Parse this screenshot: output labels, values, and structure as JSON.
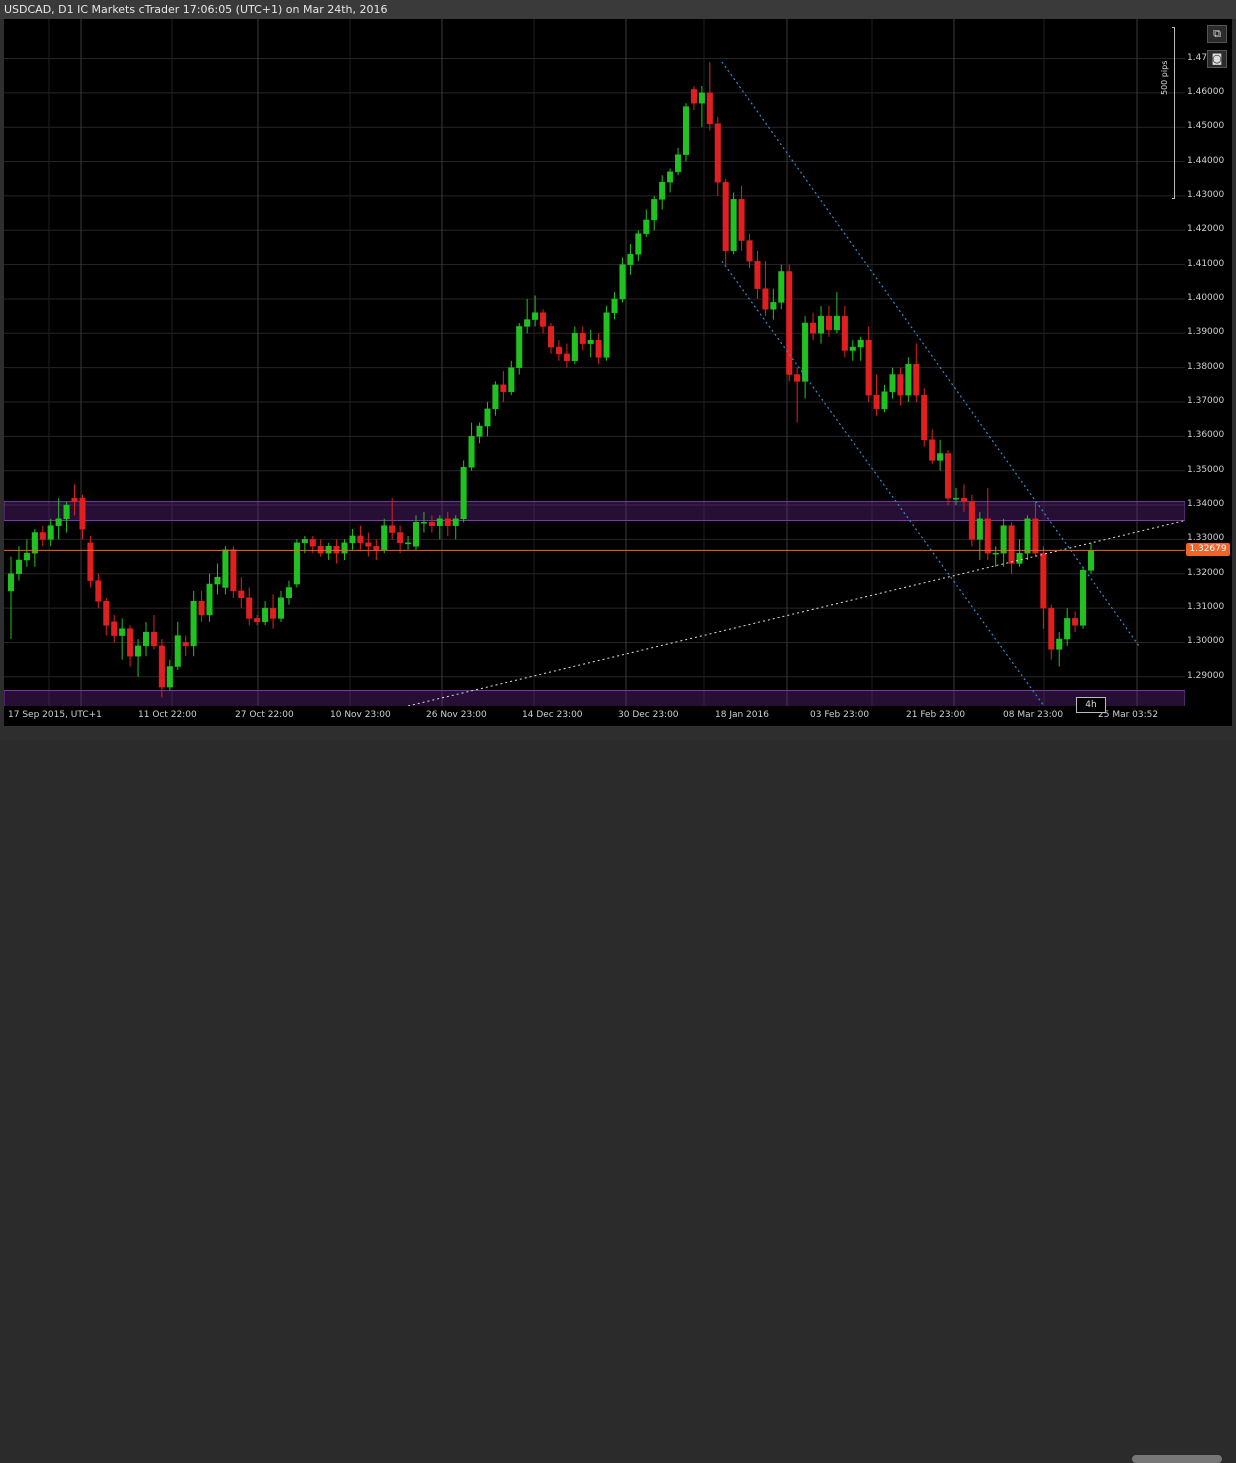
{
  "window": {
    "title": "USDCAD, D1 IC Markets cTrader 17:06:05 (UTC+1) on Mar 24th, 2016"
  },
  "toolbar": {
    "detach_icon": "detach-icon",
    "camera_icon": "camera-icon"
  },
  "measure": {
    "pips_label": "500 pips"
  },
  "price_axis": {
    "ticks": [
      "1.47000",
      "1.46000",
      "1.45000",
      "1.44000",
      "1.43000",
      "1.42000",
      "1.41000",
      "1.40000",
      "1.39000",
      "1.38000",
      "1.37000",
      "1.36000",
      "1.35000",
      "1.34000",
      "1.33000",
      "1.32000",
      "1.31000",
      "1.30000",
      "1.29000"
    ],
    "current_price": "1.32679"
  },
  "time_axis": {
    "ticks": [
      "17 Sep 2015, UTC+1",
      "11 Oct 22:00",
      "27 Oct 22:00",
      "10 Nov 23:00",
      "26 Nov 23:00",
      "14 Dec 23:00",
      "30 Dec 23:00",
      "18 Jan 2016",
      "03 Feb 23:00",
      "21 Feb 23:00",
      "08 Mar 23:00",
      "25 Mar 03:52"
    ],
    "timeframe": "4h"
  },
  "colors": {
    "bull": "#22c122",
    "bear": "#e02020",
    "zone": "#7a3aa8",
    "channel": "#2a8fd8",
    "price_line": "#f0642a"
  },
  "chart_data": {
    "type": "candlestick",
    "symbol": "USDCAD",
    "timeframe": "D1",
    "ylim": [
      1.2815,
      1.4815
    ],
    "current_price": 1.32679,
    "ohlc": [
      [
        1.315,
        1.325,
        1.301,
        1.32
      ],
      [
        1.32,
        1.328,
        1.318,
        1.324
      ],
      [
        1.324,
        1.33,
        1.322,
        1.326
      ],
      [
        1.326,
        1.333,
        1.322,
        1.332
      ],
      [
        1.332,
        1.334,
        1.328,
        1.33
      ],
      [
        1.33,
        1.336,
        1.328,
        1.334
      ],
      [
        1.334,
        1.342,
        1.33,
        1.336
      ],
      [
        1.336,
        1.341,
        1.332,
        1.34
      ],
      [
        1.342,
        1.346,
        1.337,
        1.341
      ],
      [
        1.342,
        1.343,
        1.33,
        1.333
      ],
      [
        1.329,
        1.331,
        1.316,
        1.318
      ],
      [
        1.318,
        1.32,
        1.31,
        1.312
      ],
      [
        1.312,
        1.313,
        1.302,
        1.305
      ],
      [
        1.306,
        1.308,
        1.3,
        1.302
      ],
      [
        1.302,
        1.307,
        1.295,
        1.304
      ],
      [
        1.304,
        1.305,
        1.293,
        1.296
      ],
      [
        1.296,
        1.301,
        1.29,
        1.299
      ],
      [
        1.299,
        1.306,
        1.296,
        1.303
      ],
      [
        1.303,
        1.308,
        1.298,
        1.299
      ],
      [
        1.299,
        1.301,
        1.284,
        1.287
      ],
      [
        1.287,
        1.295,
        1.286,
        1.293
      ],
      [
        1.293,
        1.306,
        1.292,
        1.302
      ],
      [
        1.3,
        1.302,
        1.296,
        1.299
      ],
      [
        1.299,
        1.315,
        1.296,
        1.312
      ],
      [
        1.312,
        1.315,
        1.306,
        1.308
      ],
      [
        1.308,
        1.32,
        1.306,
        1.317
      ],
      [
        1.317,
        1.323,
        1.314,
        1.319
      ],
      [
        1.316,
        1.328,
        1.314,
        1.327
      ],
      [
        1.327,
        1.328,
        1.313,
        1.315
      ],
      [
        1.315,
        1.319,
        1.31,
        1.313
      ],
      [
        1.313,
        1.316,
        1.305,
        1.307
      ],
      [
        1.307,
        1.308,
        1.305,
        1.306
      ],
      [
        1.306,
        1.312,
        1.305,
        1.31
      ],
      [
        1.31,
        1.314,
        1.304,
        1.307
      ],
      [
        1.307,
        1.315,
        1.306,
        1.313
      ],
      [
        1.313,
        1.318,
        1.311,
        1.316
      ],
      [
        1.317,
        1.33,
        1.316,
        1.329
      ],
      [
        1.329,
        1.331,
        1.326,
        1.33
      ],
      [
        1.33,
        1.331,
        1.326,
        1.328
      ],
      [
        1.328,
        1.33,
        1.325,
        1.326
      ],
      [
        1.326,
        1.329,
        1.324,
        1.328
      ],
      [
        1.328,
        1.33,
        1.323,
        1.326
      ],
      [
        1.326,
        1.33,
        1.324,
        1.329
      ],
      [
        1.329,
        1.333,
        1.327,
        1.331
      ],
      [
        1.331,
        1.334,
        1.327,
        1.329
      ],
      [
        1.329,
        1.332,
        1.325,
        1.328
      ],
      [
        1.328,
        1.33,
        1.324,
        1.327
      ],
      [
        1.327,
        1.336,
        1.326,
        1.334
      ],
      [
        1.334,
        1.342,
        1.33,
        1.332
      ],
      [
        1.332,
        1.334,
        1.326,
        1.329
      ],
      [
        1.329,
        1.331,
        1.327,
        1.329
      ],
      [
        1.328,
        1.337,
        1.327,
        1.335
      ],
      [
        1.335,
        1.338,
        1.332,
        1.335
      ],
      [
        1.335,
        1.337,
        1.332,
        1.334
      ],
      [
        1.334,
        1.337,
        1.33,
        1.336
      ],
      [
        1.336,
        1.338,
        1.331,
        1.334
      ],
      [
        1.334,
        1.337,
        1.33,
        1.336
      ],
      [
        1.336,
        1.353,
        1.335,
        1.351
      ],
      [
        1.351,
        1.364,
        1.35,
        1.36
      ],
      [
        1.36,
        1.364,
        1.358,
        1.363
      ],
      [
        1.363,
        1.37,
        1.36,
        1.368
      ],
      [
        1.368,
        1.376,
        1.366,
        1.375
      ],
      [
        1.375,
        1.379,
        1.37,
        1.373
      ],
      [
        1.373,
        1.382,
        1.372,
        1.38
      ],
      [
        1.38,
        1.393,
        1.378,
        1.392
      ],
      [
        1.392,
        1.4,
        1.39,
        1.394
      ],
      [
        1.394,
        1.401,
        1.392,
        1.396
      ],
      [
        1.396,
        1.397,
        1.39,
        1.392
      ],
      [
        1.392,
        1.393,
        1.384,
        1.386
      ],
      [
        1.386,
        1.388,
        1.382,
        1.384
      ],
      [
        1.384,
        1.387,
        1.38,
        1.382
      ],
      [
        1.382,
        1.392,
        1.381,
        1.39
      ],
      [
        1.39,
        1.392,
        1.385,
        1.387
      ],
      [
        1.387,
        1.391,
        1.383,
        1.388
      ],
      [
        1.388,
        1.39,
        1.381,
        1.383
      ],
      [
        1.383,
        1.398,
        1.382,
        1.396
      ],
      [
        1.396,
        1.402,
        1.394,
        1.4
      ],
      [
        1.4,
        1.412,
        1.399,
        1.41
      ],
      [
        1.41,
        1.416,
        1.407,
        1.413
      ],
      [
        1.413,
        1.42,
        1.411,
        1.419
      ],
      [
        1.419,
        1.426,
        1.418,
        1.423
      ],
      [
        1.423,
        1.43,
        1.42,
        1.429
      ],
      [
        1.429,
        1.436,
        1.426,
        1.434
      ],
      [
        1.434,
        1.438,
        1.431,
        1.437
      ],
      [
        1.437,
        1.444,
        1.436,
        1.442
      ],
      [
        1.442,
        1.457,
        1.44,
        1.456
      ],
      [
        1.461,
        1.462,
        1.455,
        1.457
      ],
      [
        1.457,
        1.462,
        1.45,
        1.46
      ],
      [
        1.46,
        1.469,
        1.449,
        1.451
      ],
      [
        1.451,
        1.453,
        1.43,
        1.434
      ],
      [
        1.434,
        1.435,
        1.41,
        1.414
      ],
      [
        1.414,
        1.431,
        1.413,
        1.429
      ],
      [
        1.429,
        1.433,
        1.414,
        1.417
      ],
      [
        1.417,
        1.419,
        1.409,
        1.411
      ],
      [
        1.411,
        1.414,
        1.4,
        1.403
      ],
      [
        1.403,
        1.411,
        1.395,
        1.397
      ],
      [
        1.397,
        1.403,
        1.394,
        1.399
      ],
      [
        1.399,
        1.41,
        1.397,
        1.408
      ],
      [
        1.408,
        1.41,
        1.376,
        1.378
      ],
      [
        1.378,
        1.38,
        1.364,
        1.376
      ],
      [
        1.376,
        1.395,
        1.371,
        1.393
      ],
      [
        1.393,
        1.396,
        1.388,
        1.39
      ],
      [
        1.39,
        1.398,
        1.387,
        1.395
      ],
      [
        1.395,
        1.398,
        1.389,
        1.391
      ],
      [
        1.391,
        1.402,
        1.39,
        1.395
      ],
      [
        1.395,
        1.398,
        1.383,
        1.385
      ],
      [
        1.385,
        1.388,
        1.382,
        1.386
      ],
      [
        1.386,
        1.389,
        1.382,
        1.388
      ],
      [
        1.388,
        1.392,
        1.37,
        1.372
      ],
      [
        1.372,
        1.378,
        1.366,
        1.368
      ],
      [
        1.368,
        1.375,
        1.367,
        1.373
      ],
      [
        1.373,
        1.38,
        1.371,
        1.378
      ],
      [
        1.378,
        1.38,
        1.369,
        1.372
      ],
      [
        1.372,
        1.383,
        1.37,
        1.381
      ],
      [
        1.381,
        1.387,
        1.37,
        1.372
      ],
      [
        1.372,
        1.374,
        1.357,
        1.359
      ],
      [
        1.359,
        1.362,
        1.352,
        1.353
      ],
      [
        1.353,
        1.359,
        1.35,
        1.355
      ],
      [
        1.355,
        1.356,
        1.34,
        1.342
      ],
      [
        1.342,
        1.345,
        1.34,
        1.342
      ],
      [
        1.342,
        1.346,
        1.338,
        1.341
      ],
      [
        1.341,
        1.343,
        1.328,
        1.33
      ],
      [
        1.33,
        1.338,
        1.324,
        1.336
      ],
      [
        1.336,
        1.345,
        1.324,
        1.326
      ],
      [
        1.326,
        1.328,
        1.322,
        1.326
      ],
      [
        1.326,
        1.336,
        1.322,
        1.334
      ],
      [
        1.334,
        1.335,
        1.32,
        1.323
      ],
      [
        1.323,
        1.33,
        1.322,
        1.326
      ],
      [
        1.326,
        1.337,
        1.324,
        1.336
      ],
      [
        1.336,
        1.341,
        1.325,
        1.326
      ],
      [
        1.326,
        1.328,
        1.304,
        1.31
      ],
      [
        1.31,
        1.311,
        1.295,
        1.298
      ],
      [
        1.298,
        1.303,
        1.293,
        1.301
      ],
      [
        1.301,
        1.31,
        1.299,
        1.307
      ],
      [
        1.307,
        1.309,
        1.303,
        1.305
      ],
      [
        1.305,
        1.322,
        1.304,
        1.321
      ],
      [
        1.321,
        1.329,
        1.32,
        1.3268
      ]
    ]
  }
}
